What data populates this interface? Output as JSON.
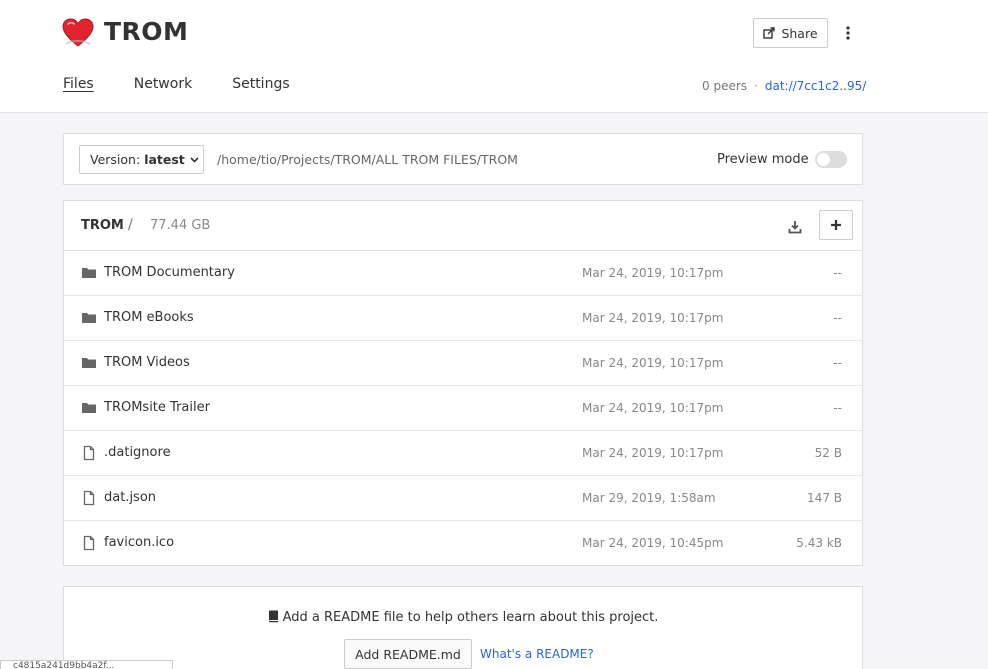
{
  "site": {
    "title": "TROM"
  },
  "header": {
    "share_label": "Share",
    "more_icon": "more-vertical-icon"
  },
  "nav": {
    "tabs": [
      {
        "label": "Files",
        "active": true
      },
      {
        "label": "Network",
        "active": false
      },
      {
        "label": "Settings",
        "active": false
      }
    ]
  },
  "peers": {
    "count_text": "0 peers",
    "separator": "·",
    "url": "dat://7cc1c2..95/"
  },
  "toolbar": {
    "version_prefix": "Version:",
    "version_value": "latest",
    "path": "/home/tio/Projects/TROM/ALL TROM FILES/TROM",
    "preview_label": "Preview mode",
    "preview_enabled": false
  },
  "files": {
    "breadcrumb": "TROM",
    "separator": "/",
    "total_size": "77.44 GB",
    "rows": [
      {
        "type": "folder",
        "name": "TROM Documentary",
        "date": "Mar 24, 2019, 10:17pm",
        "size": "--"
      },
      {
        "type": "folder",
        "name": "TROM eBooks",
        "date": "Mar 24, 2019, 10:17pm",
        "size": "--"
      },
      {
        "type": "folder",
        "name": "TROM Videos",
        "date": "Mar 24, 2019, 10:17pm",
        "size": "--"
      },
      {
        "type": "folder",
        "name": "TROMsite Trailer",
        "date": "Mar 24, 2019, 10:17pm",
        "size": "--"
      },
      {
        "type": "file",
        "name": ".datignore",
        "date": "Mar 24, 2019, 10:17pm",
        "size": "52 B"
      },
      {
        "type": "file",
        "name": "dat.json",
        "date": "Mar 29, 2019, 1:58am",
        "size": "147 B"
      },
      {
        "type": "file",
        "name": "favicon.ico",
        "date": "Mar 24, 2019, 10:45pm",
        "size": "5.43 kB"
      }
    ]
  },
  "readme": {
    "message": "Add a README file to help others learn about this project.",
    "button_label": "Add README.md",
    "link_label": "What's a README?"
  },
  "statusbar": {
    "text": "c4815a241d9bb4a2f..."
  },
  "colors": {
    "accent": "#2864dc",
    "logo_red": "#e3232d"
  }
}
